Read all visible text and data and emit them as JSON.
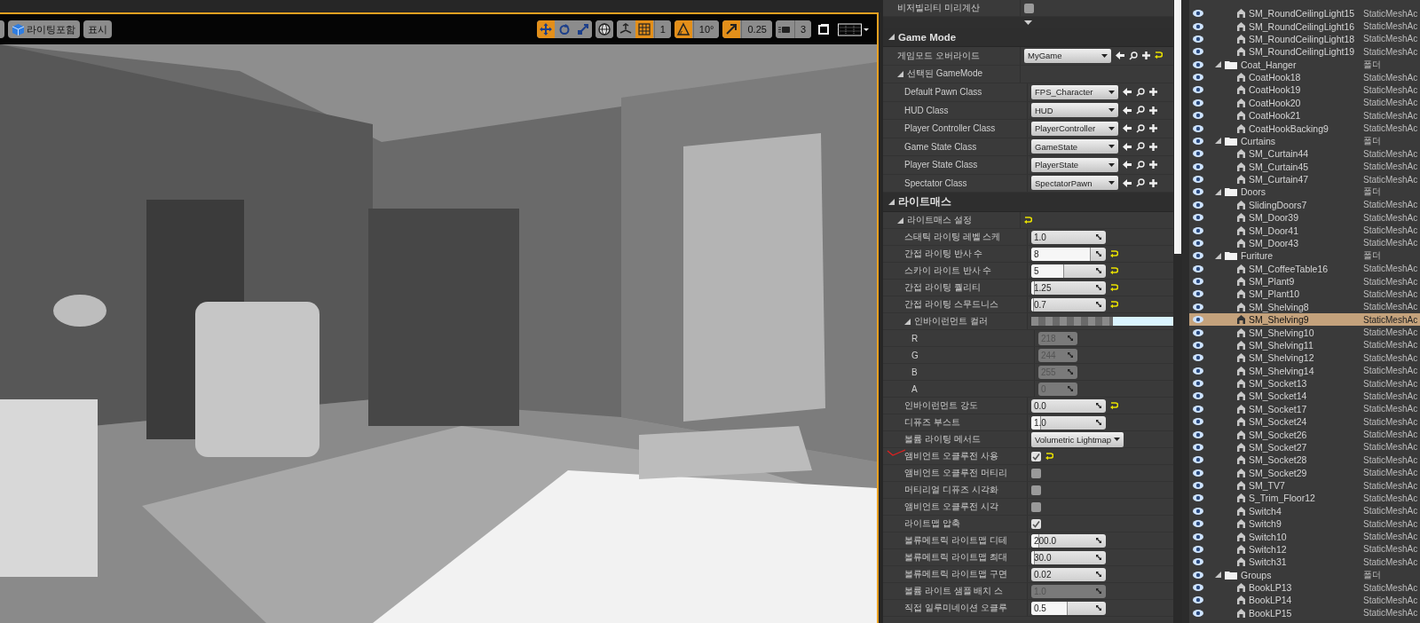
{
  "viewport": {
    "toolbar": {
      "left": [
        {
          "kind": "with_icon",
          "label": "라이팅포함"
        },
        {
          "kind": "plain",
          "label": "표시"
        }
      ],
      "right": [
        {
          "items": [
            {
              "kind": "move",
              "on": true
            },
            {
              "kind": "rotate",
              "on": false
            },
            {
              "kind": "scale",
              "on": false
            }
          ]
        },
        {
          "items": [
            {
              "kind": "world",
              "on": false
            }
          ]
        },
        {
          "items": [
            {
              "kind": "surface_snap",
              "on": false
            },
            {
              "kind": "grid_snap",
              "on": true,
              "value": "1"
            }
          ]
        },
        {
          "items": [
            {
              "kind": "rotation_snap",
              "on": true,
              "value": "10°"
            }
          ]
        },
        {
          "items": [
            {
              "kind": "scale_snap",
              "on": true,
              "value": "0.25"
            }
          ]
        },
        {
          "items": [
            {
              "kind": "camera_speed",
              "on": false,
              "value": "3"
            }
          ]
        },
        {
          "items": [
            {
              "kind": "maximize",
              "on": false
            }
          ]
        },
        {
          "items": [
            {
              "kind": "layout",
              "on": false
            }
          ]
        }
      ]
    }
  },
  "details": {
    "top_rows": [
      {
        "kind": "checkbox",
        "label": "비저빌리티 미리계산",
        "checked": false,
        "marked": false
      }
    ],
    "categories": [
      {
        "title": "Game Mode",
        "expanded": true,
        "children": [
          {
            "kind": "class_picker",
            "label": "게임모드 오버라이드",
            "value": "MyGame",
            "resettable": true
          },
          {
            "kind": "group",
            "label": "선택된 GameMode",
            "expanded": true,
            "resettable": false,
            "children": [
              {
                "kind": "class_picker",
                "label": "Default Pawn Class",
                "value": "FPS_Character",
                "resettable": false
              },
              {
                "kind": "class_picker",
                "label": "HUD Class",
                "value": "HUD",
                "resettable": false
              },
              {
                "kind": "class_picker",
                "label": "Player Controller Class",
                "value": "PlayerController",
                "resettable": false
              },
              {
                "kind": "class_picker",
                "label": "Game State Class",
                "value": "GameState",
                "resettable": false
              },
              {
                "kind": "class_picker",
                "label": "Player State Class",
                "value": "PlayerState",
                "resettable": false
              },
              {
                "kind": "class_picker",
                "label": "Spectator Class",
                "value": "SpectatorPawn",
                "resettable": false
              }
            ]
          }
        ]
      },
      {
        "title": "라이트매스",
        "expanded": true,
        "children": [
          {
            "kind": "group",
            "label": "라이트매스 설정",
            "expanded": true,
            "resettable": true,
            "children": [
              {
                "kind": "number",
                "label": "스태틱 라이팅 레벨 스케",
                "value": "1.0",
                "disabled": false,
                "resettable": false
              },
              {
                "kind": "number",
                "label": "간접 라이팅 반사 수",
                "value": "8",
                "level": 0.78,
                "disabled": false,
                "resettable": true
              },
              {
                "kind": "number",
                "label": "스카이 라이트 반사 수",
                "value": "5",
                "level": 0.43,
                "disabled": false,
                "resettable": true
              },
              {
                "kind": "number",
                "label": "간접 라이팅 퀄리티",
                "value": "1.25",
                "level": 0.04,
                "disabled": false,
                "resettable": true
              },
              {
                "kind": "number",
                "label": "간접 라이팅 스무드니스",
                "value": "0.7",
                "level": 0.02,
                "disabled": false,
                "resettable": true
              },
              {
                "kind": "color",
                "label": "인바이런먼트 컬러",
                "color": "#daf4ff",
                "expanded": true,
                "resettable": false,
                "children": [
                  {
                    "kind": "channel",
                    "label": "R",
                    "value": "218",
                    "disabled": true,
                    "resettable": false
                  },
                  {
                    "kind": "channel",
                    "label": "G",
                    "value": "244",
                    "disabled": true,
                    "resettable": false
                  },
                  {
                    "kind": "channel",
                    "label": "B",
                    "value": "255",
                    "disabled": true,
                    "resettable": false
                  },
                  {
                    "kind": "channel",
                    "label": "A",
                    "value": "0",
                    "disabled": true,
                    "resettable": false
                  }
                ]
              },
              {
                "kind": "number",
                "label": "인바이런먼트 강도",
                "value": "0.0",
                "disabled": false,
                "resettable": true
              },
              {
                "kind": "number",
                "label": "디퓨즈 부스트",
                "value": "1.0",
                "level": 0.12,
                "disabled": false,
                "resettable": false
              },
              {
                "kind": "dropdown",
                "label": "볼륨 라이팅 메서드",
                "value": "Volumetric Lightmap",
                "resettable": false
              },
              {
                "kind": "checkbox",
                "label": "앰비언트 오클루전 사용",
                "checked": true,
                "marked": true,
                "resettable": true
              },
              {
                "kind": "checkbox",
                "label": "앰비언트 오클루전 머티리",
                "checked": false,
                "marked": false,
                "resettable": false
              },
              {
                "kind": "checkbox",
                "label": "머티리얼 디퓨즈 시각화",
                "checked": false,
                "marked": false,
                "resettable": false
              },
              {
                "kind": "checkbox",
                "label": "앰비언트 오클루전 시각",
                "checked": false,
                "marked": false,
                "resettable": false
              },
              {
                "kind": "checkbox",
                "label": "라이트맵 압축",
                "checked": true,
                "marked": false,
                "resettable": false
              },
              {
                "kind": "number",
                "label": "볼류메트릭 라이트맵 디테",
                "value": "200.0",
                "level": 0.1,
                "disabled": false,
                "resettable": false
              },
              {
                "kind": "number",
                "label": "볼류메트릭 라이트맵 최대",
                "value": "30.0",
                "level": 0.04,
                "disabled": false,
                "resettable": false
              },
              {
                "kind": "number",
                "label": "볼류메트릭 라이트맵 구면",
                "value": "0.02",
                "disabled": false,
                "resettable": false
              },
              {
                "kind": "number",
                "label": "볼륨 라이트 샘플 배치 스",
                "value": "1.0",
                "disabled": true,
                "resettable": false
              },
              {
                "kind": "number",
                "label": "직접 일루미네이션 오클루",
                "value": "0.5",
                "level": 0.48,
                "disabled": false,
                "resettable": false
              }
            ]
          }
        ]
      }
    ]
  },
  "outliner": {
    "folders": [
      {
        "children": [
          {
            "name": "SM_RoundCeilingLight15",
            "type": "StaticMeshAc",
            "selected": false
          },
          {
            "name": "SM_RoundCeilingLight16",
            "type": "StaticMeshAc",
            "selected": false
          },
          {
            "name": "SM_RoundCeilingLight18",
            "type": "StaticMeshAc",
            "selected": false
          },
          {
            "name": "SM_RoundCeilingLight19",
            "type": "StaticMeshAc",
            "selected": false
          }
        ]
      },
      {
        "name": "Coat_Hanger",
        "type": "폴더",
        "selected": false,
        "expanded": true,
        "children": [
          {
            "name": "CoatHook18",
            "type": "StaticMeshAc",
            "selected": false
          },
          {
            "name": "CoatHook19",
            "type": "StaticMeshAc",
            "selected": false
          },
          {
            "name": "CoatHook20",
            "type": "StaticMeshAc",
            "selected": false
          },
          {
            "name": "CoatHook21",
            "type": "StaticMeshAc",
            "selected": false
          },
          {
            "name": "CoatHookBacking9",
            "type": "StaticMeshAc",
            "selected": false
          }
        ]
      },
      {
        "name": "Curtains",
        "type": "폴더",
        "selected": false,
        "expanded": true,
        "children": [
          {
            "name": "SM_Curtain44",
            "type": "StaticMeshAc",
            "selected": false
          },
          {
            "name": "SM_Curtain45",
            "type": "StaticMeshAc",
            "selected": false
          },
          {
            "name": "SM_Curtain47",
            "type": "StaticMeshAc",
            "selected": false
          }
        ]
      },
      {
        "name": "Doors",
        "type": "폴더",
        "selected": false,
        "expanded": true,
        "children": [
          {
            "name": "SlidingDoors7",
            "type": "StaticMeshAc",
            "selected": false
          },
          {
            "name": "SM_Door39",
            "type": "StaticMeshAc",
            "selected": false
          },
          {
            "name": "SM_Door41",
            "type": "StaticMeshAc",
            "selected": false
          },
          {
            "name": "SM_Door43",
            "type": "StaticMeshAc",
            "selected": false
          }
        ]
      },
      {
        "name": "Furiture",
        "type": "폴더",
        "selected": false,
        "expanded": true,
        "children": [
          {
            "name": "SM_CoffeeTable16",
            "type": "StaticMeshAc",
            "selected": false
          },
          {
            "name": "SM_Plant9",
            "type": "StaticMeshAc",
            "selected": false
          },
          {
            "name": "SM_Plant10",
            "type": "StaticMeshAc",
            "selected": false
          },
          {
            "name": "SM_Shelving8",
            "type": "StaticMeshAc",
            "selected": false
          },
          {
            "name": "SM_Shelving9",
            "type": "StaticMeshAc",
            "selected": true
          },
          {
            "name": "SM_Shelving10",
            "type": "StaticMeshAc",
            "selected": false
          },
          {
            "name": "SM_Shelving11",
            "type": "StaticMeshAc",
            "selected": false
          },
          {
            "name": "SM_Shelving12",
            "type": "StaticMeshAc",
            "selected": false
          },
          {
            "name": "SM_Shelving14",
            "type": "StaticMeshAc",
            "selected": false
          },
          {
            "name": "SM_Socket13",
            "type": "StaticMeshAc",
            "selected": false
          },
          {
            "name": "SM_Socket14",
            "type": "StaticMeshAc",
            "selected": false
          },
          {
            "name": "SM_Socket17",
            "type": "StaticMeshAc",
            "selected": false
          },
          {
            "name": "SM_Socket24",
            "type": "StaticMeshAc",
            "selected": false
          },
          {
            "name": "SM_Socket26",
            "type": "StaticMeshAc",
            "selected": false
          },
          {
            "name": "SM_Socket27",
            "type": "StaticMeshAc",
            "selected": false
          },
          {
            "name": "SM_Socket28",
            "type": "StaticMeshAc",
            "selected": false
          },
          {
            "name": "SM_Socket29",
            "type": "StaticMeshAc",
            "selected": false
          },
          {
            "name": "SM_TV7",
            "type": "StaticMeshAc",
            "selected": false
          },
          {
            "name": "S_Trim_Floor12",
            "type": "StaticMeshAc",
            "selected": false
          },
          {
            "name": "Switch4",
            "type": "StaticMeshAc",
            "selected": false
          },
          {
            "name": "Switch9",
            "type": "StaticMeshAc",
            "selected": false
          },
          {
            "name": "Switch10",
            "type": "StaticMeshAc",
            "selected": false
          },
          {
            "name": "Switch12",
            "type": "StaticMeshAc",
            "selected": false
          },
          {
            "name": "Switch31",
            "type": "StaticMeshAc",
            "selected": false
          }
        ]
      },
      {
        "name": "Groups",
        "type": "폴더",
        "selected": false,
        "expanded": true,
        "children": [
          {
            "name": "BookLP13",
            "type": "StaticMeshAc",
            "selected": false
          },
          {
            "name": "BookLP14",
            "type": "StaticMeshAc",
            "selected": false
          },
          {
            "name": "BookLP15",
            "type": "StaticMeshAc",
            "selected": false
          }
        ]
      }
    ]
  }
}
